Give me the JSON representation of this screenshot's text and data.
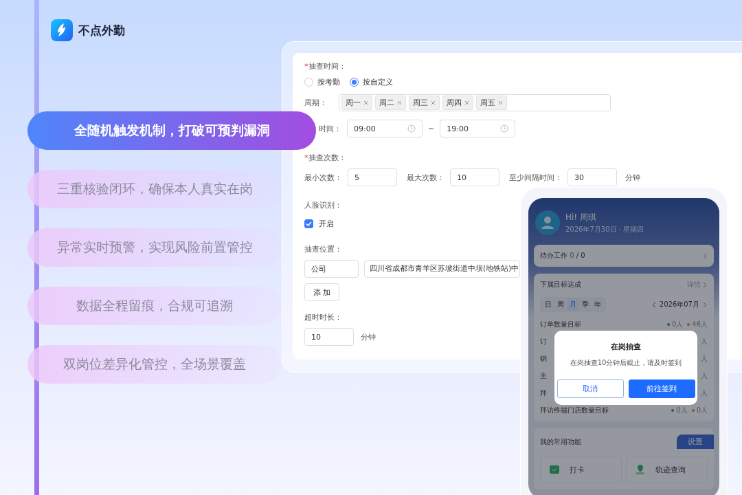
{
  "brand": {
    "name": "不点外勤"
  },
  "features": [
    {
      "text": "全随机触发机制，打破可预判漏洞",
      "selected": true
    },
    {
      "text": "三重核验闭环，确保本人真实在岗",
      "selected": false
    },
    {
      "text": "异常实时预警，实现风险前置管控",
      "selected": false
    },
    {
      "text": "数据全程留痕，合规可追溯",
      "selected": false
    },
    {
      "text": "双岗位差异化管控，全场景覆盖",
      "selected": false
    }
  ],
  "form": {
    "check_time": {
      "required_mark": "*",
      "label": "抽查时间：",
      "options": [
        {
          "label": "按考勤",
          "selected": false
        },
        {
          "label": "按自定义",
          "selected": true
        }
      ]
    },
    "period": {
      "label": "周期：",
      "tags": [
        "周一",
        "周二",
        "周三",
        "周四",
        "周五"
      ]
    },
    "time": {
      "label": "时间：",
      "start": "09:00",
      "separator": "~",
      "end": "19:00"
    },
    "count": {
      "required_mark": "*",
      "label": "抽查次数：",
      "fields": [
        {
          "label": "最小次数：",
          "value": "5"
        },
        {
          "label": "最大次数：",
          "value": "10"
        },
        {
          "label": "至少间隔时间：",
          "value": "30"
        }
      ],
      "unit": "分钟"
    },
    "face": {
      "label": "人脸识别：",
      "option": {
        "label": "开启",
        "checked": true
      }
    },
    "location": {
      "label": "抽查位置：",
      "name": "公司",
      "address": "四川省成都市青羊区苏坡街道中坝(地铁站)中",
      "button": "添 加"
    },
    "timeout": {
      "label": "超时时长：",
      "value": "10",
      "unit": "分钟"
    }
  },
  "phone": {
    "greeting": "Hi!  周琪",
    "date": "2026年7月30日 · 星期四",
    "todo": {
      "label": "待办工作",
      "done": "0",
      "total": "/ 0"
    },
    "goals": {
      "title": "下属目标达成",
      "link": "详情",
      "periods": [
        {
          "label": "日",
          "selected": false
        },
        {
          "label": "周",
          "selected": false
        },
        {
          "label": "月",
          "selected": true
        },
        {
          "label": "季",
          "selected": false
        },
        {
          "label": "年",
          "selected": false
        }
      ],
      "month": "2026年07月",
      "rows": [
        {
          "label": "订单数量目标",
          "values": [
            {
              "text": "0人",
              "kind": "done"
            },
            {
              "text": "46人",
              "kind": "pending"
            }
          ]
        },
        {
          "label": "订",
          "values": [
            {
              "text": "人",
              "kind": "plain"
            }
          ]
        },
        {
          "label": "销",
          "values": [
            {
              "text": "人",
              "kind": "plain"
            }
          ]
        },
        {
          "label": "主",
          "values": [
            {
              "text": "人",
              "kind": "plain"
            }
          ]
        },
        {
          "label": "拜",
          "values": [
            {
              "text": "人",
              "kind": "plain"
            }
          ]
        },
        {
          "label": "拜访终端门店数量目标",
          "values": [
            {
              "text": "0人",
              "kind": "done"
            },
            {
              "text": "0人",
              "kind": "pending"
            }
          ]
        }
      ]
    },
    "dialog": {
      "title": "在岗抽查",
      "message": "在岗抽查10分钟后截止，请及时签到",
      "buttons": [
        {
          "label": "取消",
          "kind": "secondary"
        },
        {
          "label": "前往签到",
          "kind": "primary"
        }
      ]
    },
    "functions": {
      "title": "我的常用功能",
      "settings": "设置",
      "items": [
        {
          "label": "打卡",
          "kind": "clock"
        },
        {
          "label": "轨迹查询",
          "kind": "track"
        }
      ]
    }
  }
}
